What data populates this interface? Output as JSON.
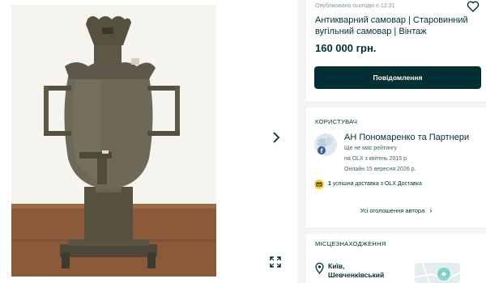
{
  "listing": {
    "published": "Опубліковано сьогодні о 12:31",
    "title": "Антикварний самовар | Старовинний вугільний самовар | Вінтаж",
    "price": "160 000 грн.",
    "message_button": "Повідомлення"
  },
  "seller": {
    "section_label": "КОРИСТУВАЧ",
    "name": "АН Пономаренко та Партнери",
    "rating": "Ще не має рейтингу",
    "since": "на OLX з квітень 2015 р.",
    "online": "Онлайн 15 вересня 2026 р.",
    "delivery_count": "1",
    "delivery_text": "успішна доставка з OLX Доставка",
    "all_ads": "Усі оголошення автора"
  },
  "location": {
    "section_label": "МІСЦЕЗНАХОДЖЕННЯ",
    "city": "Київ,",
    "district": "Шевченківський"
  },
  "icons": {
    "favorite": "heart-icon",
    "next": "chevron-right-icon",
    "fullscreen": "expand-icon",
    "delivery": "delivery-icon",
    "location": "map-pin-icon"
  },
  "colors": {
    "brand_dark": "#002f34",
    "background": "#f2f4f5",
    "delivery_badge": "#ffce32"
  }
}
